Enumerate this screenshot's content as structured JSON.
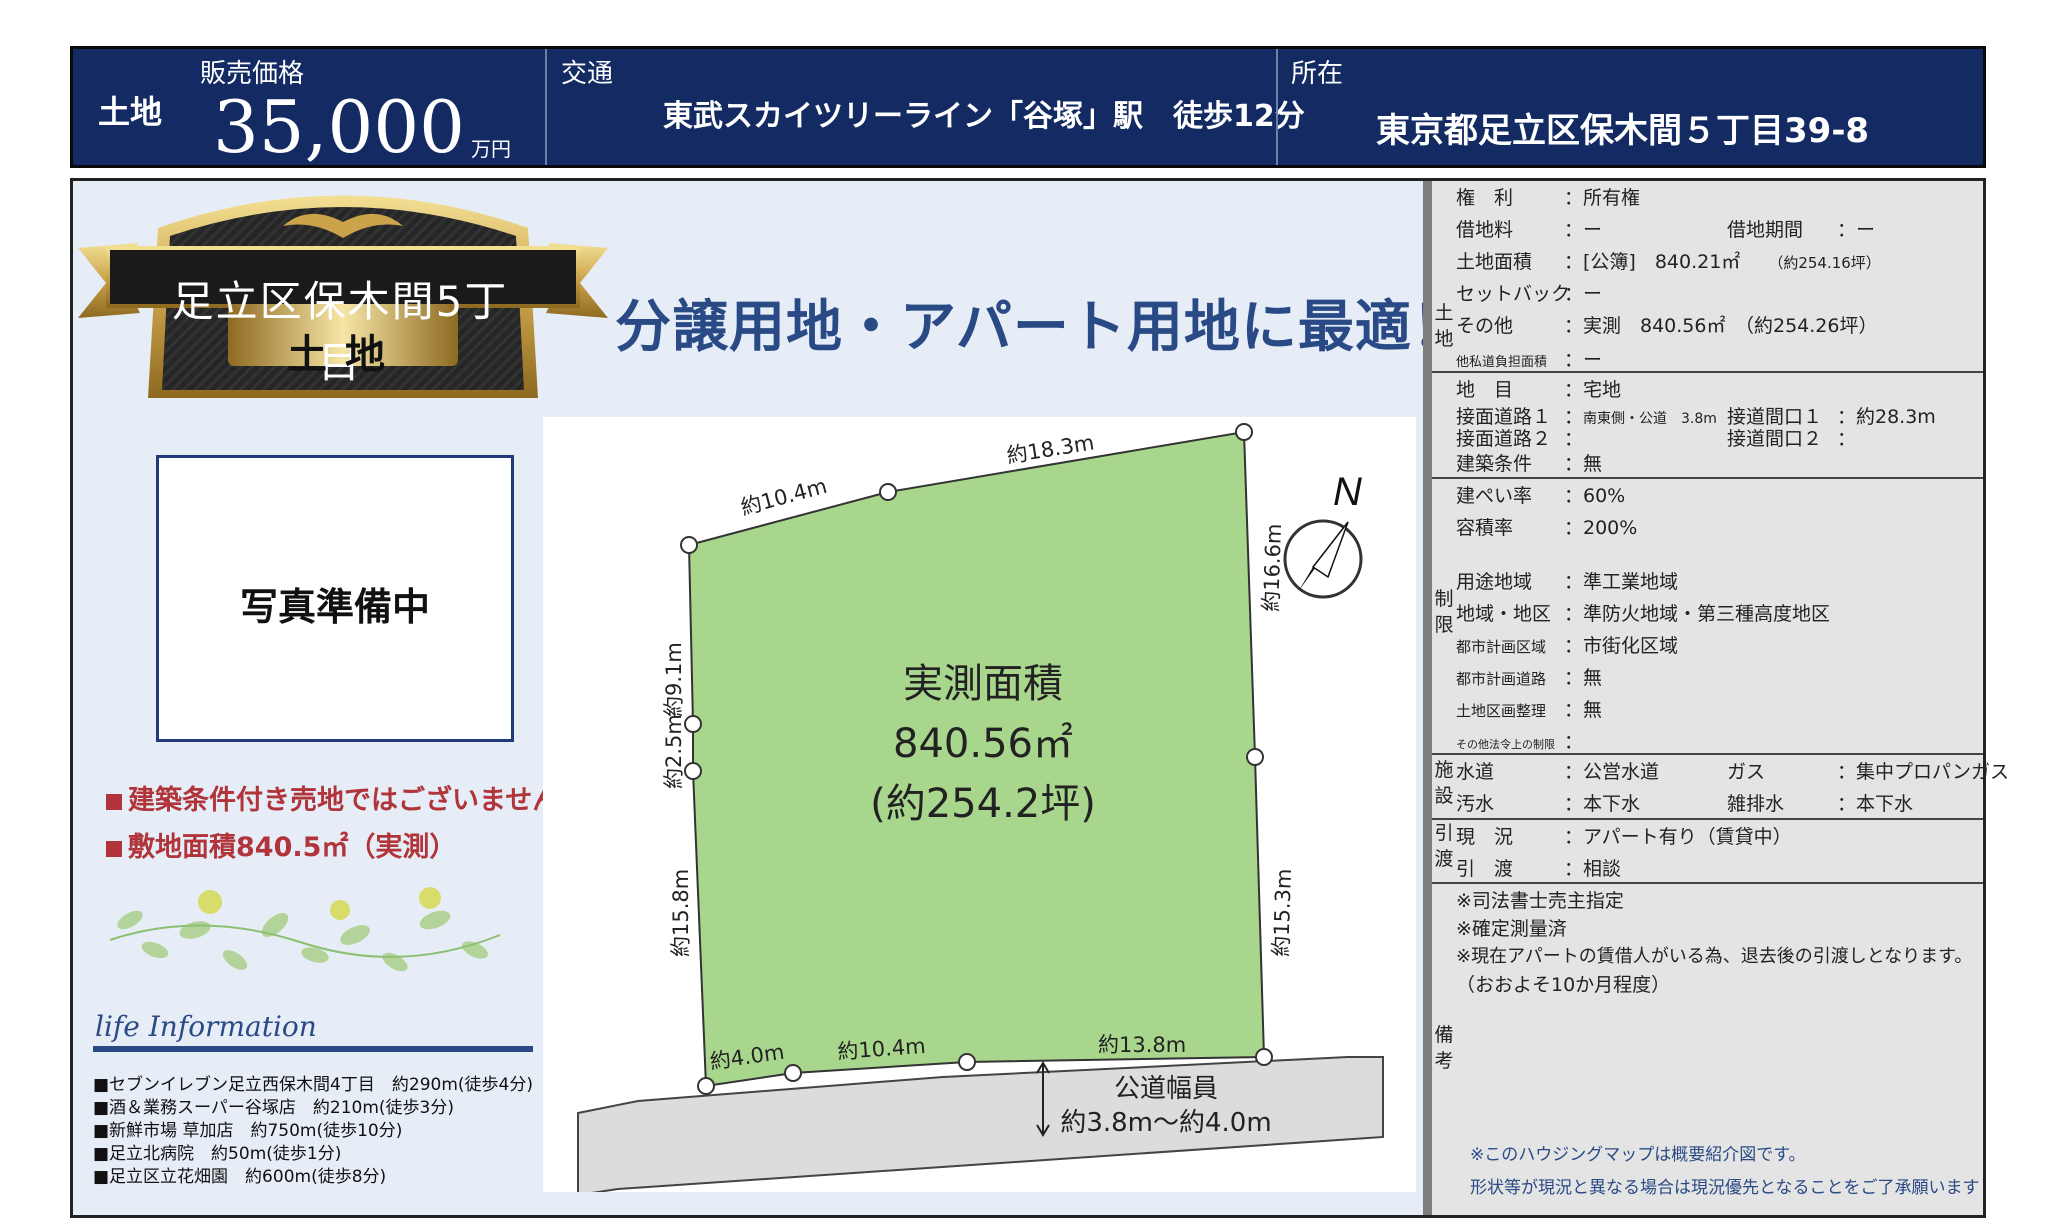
{
  "header": {
    "category": "土地",
    "price_label": "販売価格",
    "price": "35,000",
    "price_unit": "万円",
    "transport_label": "交通",
    "transport": "東武スカイツリーライン「谷塚」駅　徒歩12分",
    "location_label": "所在",
    "location": "東京都足立区保木間５丁目39-8"
  },
  "badge": {
    "line1": "足立区保木間5丁目",
    "line2": "土地"
  },
  "headline": "分譲用地・アパート用地に最適！",
  "photo_placeholder": "写真準備中",
  "highlights": [
    "建築条件付き売地ではございません",
    "敷地面積840.5㎡（実測）"
  ],
  "life_info": {
    "title": "life Information",
    "items": [
      "■セブンイレブン足立西保木間4丁目　約290m(徒歩4分)",
      "■酒＆業務スーパー谷塚店　約210m(徒歩3分)",
      "■新鮮市場 草加店　約750m(徒歩10分)",
      "■足立北病院　約50m(徒歩1分)",
      "■足立区立花畑園　約600m(徒歩8分)"
    ]
  },
  "plot": {
    "area_title": "実測面積",
    "area_sqm": "840.56㎡",
    "area_tsubo": "(約254.2坪)",
    "north": "N",
    "road_title": "公道幅員",
    "road_width": "約3.8m～約4.0m",
    "dims": {
      "top_left": "約10.4m",
      "top_right": "約18.3m",
      "right_upper": "約16.6m",
      "right_lower": "約15.3m",
      "left_upper": "約9.1m",
      "left_mid": "約2.5m",
      "left_lower": "約15.8m",
      "bottom_left": "約4.0m",
      "bottom_mid": "約10.4m",
      "bottom_right": "約13.8m"
    }
  },
  "spec": {
    "cat_land": "土地",
    "cat_restrict": "制限",
    "cat_facility": "施設",
    "cat_handover": "引渡",
    "cat_notes": "備考",
    "rights": {
      "label": "権　利",
      "value": "：所有権"
    },
    "lease_fee": {
      "label": "借地料",
      "value": "：ー"
    },
    "lease_term": {
      "label": "借地期間",
      "value": "：ー"
    },
    "land_area": {
      "label": "土地面積",
      "value": "：[公簿]　840.21㎡",
      "sub": "（約254.16坪）"
    },
    "setback": {
      "label": "セットバック",
      "value": "：ー"
    },
    "other": {
      "label": "その他",
      "value": "：実測　840.56㎡　（約254.26坪）"
    },
    "private_road": {
      "label": "他私道負担面積",
      "value": "：ー"
    },
    "land_type": {
      "label": "地　目",
      "value": "：宅地"
    },
    "road1": {
      "label": "接面道路１",
      "value": "：",
      "detail": "南東側・公道　3.8m"
    },
    "frontage1": {
      "label": "接道間口１",
      "value": "：約28.3m"
    },
    "road2": {
      "label": "接面道路２",
      "value": "："
    },
    "frontage2": {
      "label": "接道間口２",
      "value": "："
    },
    "conditions": {
      "label": "建築条件",
      "value": "：無"
    },
    "coverage": {
      "label": "建ぺい率",
      "value": "：60%"
    },
    "floor_ratio": {
      "label": "容積率",
      "value": "：200%"
    },
    "zoning": {
      "label": "用途地域",
      "value": "：準工業地域"
    },
    "district": {
      "label": "地域・地区",
      "value": "：準防火地域・第三種高度地区"
    },
    "city_plan_area": {
      "label": "都市計画区域",
      "value": "：市街化区域"
    },
    "city_plan_road": {
      "label": "都市計画道路",
      "value": "：無"
    },
    "readjustment": {
      "label": "土地区画整理",
      "value": "：無"
    },
    "other_law": {
      "label": "その他法令上の制限",
      "value": "："
    },
    "water": {
      "label": "水道",
      "value": "：公営水道"
    },
    "gas": {
      "label": "ガス",
      "value": "：集中プロパンガス"
    },
    "sewage": {
      "label": "汚水",
      "value": "：本下水"
    },
    "drainage": {
      "label": "雑排水",
      "value": "：本下水"
    },
    "status": {
      "label": "現　況",
      "value": "：アパート有り（賃貸中）"
    },
    "handover": {
      "label": "引　渡",
      "value": "：相談"
    },
    "notes": [
      "※司法書士売主指定",
      "※確定測量済",
      "※現在アパートの賃借人がいる為、退去後の引渡しとなります。",
      "（おおよそ10か月程度）"
    ],
    "footnotes": [
      "※このハウジングマップは概要紹介図です。",
      "形状等が現況と異なる場合は現況優先となることをご了承願います"
    ]
  },
  "colors": {
    "header_bg": "#132a62",
    "plot_green": "#a9d68d",
    "accent_blue": "#2a4a86",
    "highlight_red": "#b0343a",
    "panel_bg": "#e6edf6",
    "spec_bg": "#e4e4e4"
  }
}
